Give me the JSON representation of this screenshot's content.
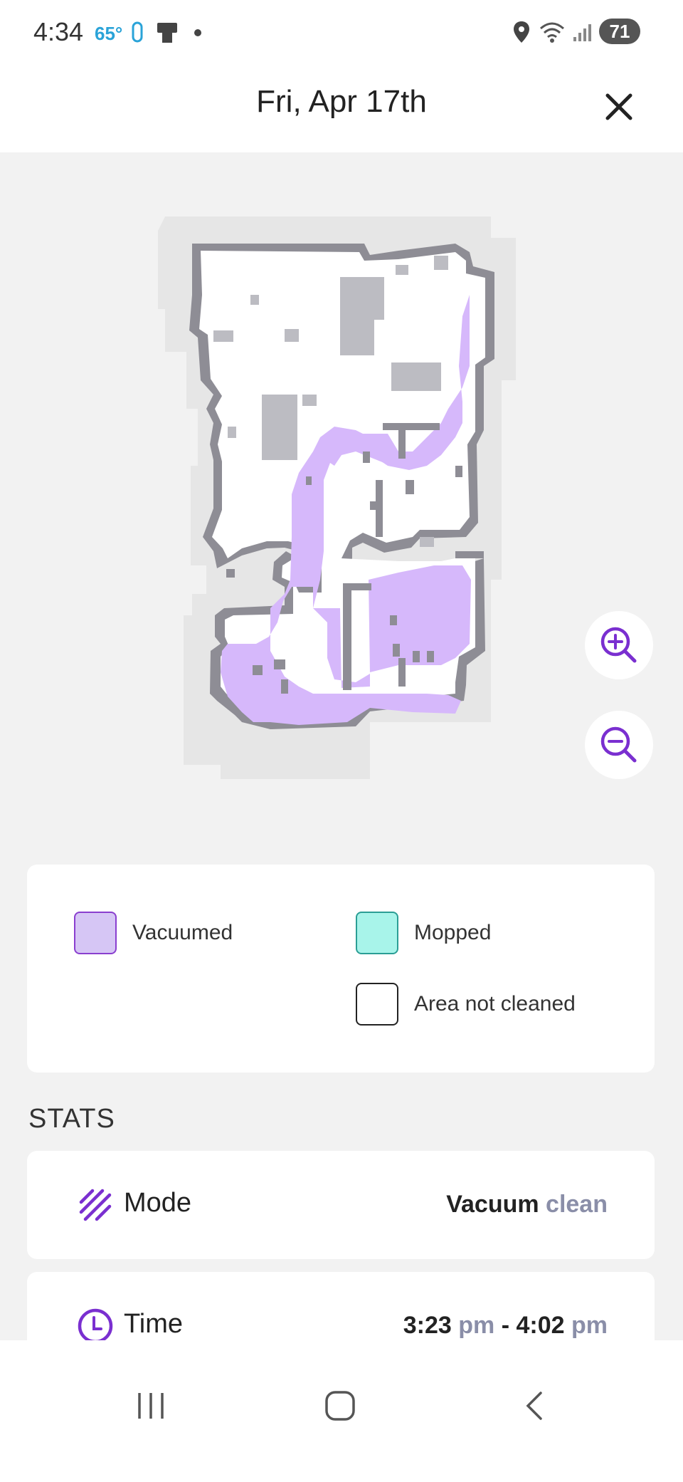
{
  "status_bar": {
    "time": "4:34",
    "temperature": "65°",
    "battery": "71",
    "icons": [
      "oral-b-icon",
      "device-icon",
      "dot-icon",
      "location-icon",
      "wifi-icon",
      "signal-icon"
    ]
  },
  "header": {
    "title": "Fri, Apr 17th",
    "close_icon": "close-icon"
  },
  "map": {
    "zoom_in_icon": "zoom-in-icon",
    "zoom_out_icon": "zoom-out-icon"
  },
  "legend": {
    "vacuumed": {
      "label": "Vacuumed",
      "color": "#d6c6f5",
      "border": "#8a3fcf"
    },
    "mopped": {
      "label": "Mopped",
      "color": "#a8f4ea",
      "border": "#2b9e95"
    },
    "not_cleaned": {
      "label": "Area not cleaned",
      "color": "#ffffff",
      "border": "#222222"
    }
  },
  "stats": {
    "section_title": "STATS",
    "mode": {
      "label": "Mode",
      "value_strong": "Vacuum",
      "value_muted": "clean"
    },
    "time": {
      "label": "Time",
      "start": "3:23",
      "start_unit": "pm",
      "separator": "-",
      "end": "4:02",
      "end_unit": "pm"
    }
  },
  "colors": {
    "accent": "#7a2fd0",
    "vacuumed_fill": "#d6b8fb"
  }
}
